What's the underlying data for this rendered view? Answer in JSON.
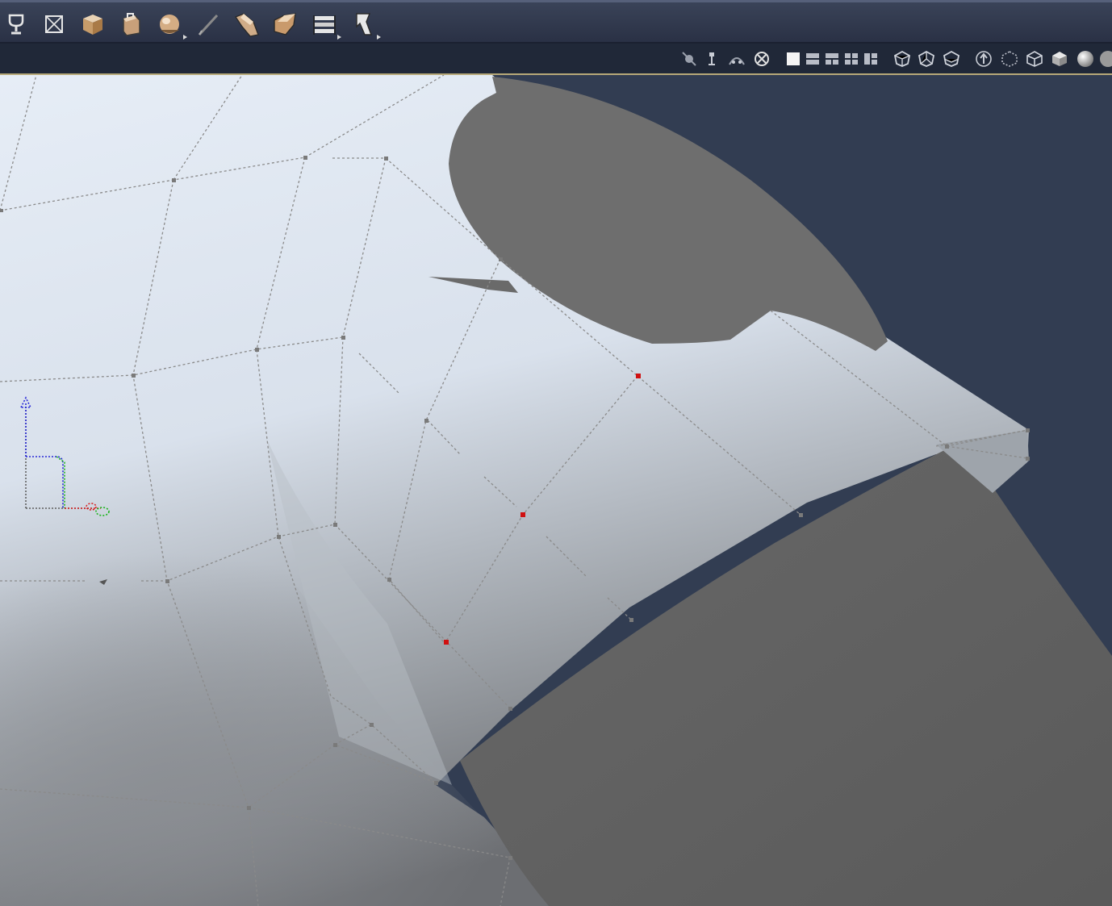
{
  "toolbar": {
    "tools": [
      {
        "name": "chalice-tool-icon"
      },
      {
        "name": "box-wireframe-tool-icon"
      },
      {
        "name": "cube-tool-icon"
      },
      {
        "name": "bag-tool-icon"
      },
      {
        "name": "sphere-tool-icon"
      },
      {
        "name": "pen-tool-icon"
      },
      {
        "name": "morph-tool-icon"
      },
      {
        "name": "twist-tool-icon"
      },
      {
        "name": "taper-tool-icon"
      },
      {
        "name": "bend-tool-icon"
      }
    ]
  },
  "viewbar": {
    "icons": [
      "camera-pan-icon",
      "camera-move-icon",
      "camera-orbit-icon",
      "camera-rotate-icon",
      "layout-single-icon",
      "layout-two-horizontal-icon",
      "layout-two-vertical-icon",
      "layout-four-icon",
      "layout-three-icon",
      "view-front-icon",
      "view-side-icon",
      "view-top-icon",
      "up-axis-icon",
      "bounding-box-icon",
      "wireframe-cube-icon",
      "solid-cube-icon",
      "smooth-shaded-icon",
      "texture-shaded-icon"
    ]
  },
  "colors": {
    "background": "#323d52",
    "mesh_light": "#e4ebf4",
    "dark_part": "#676767",
    "selected_vertex": "#d01010",
    "x_axis": "#d02020",
    "y_axis": "#20b020",
    "z_axis": "#2020d0"
  }
}
